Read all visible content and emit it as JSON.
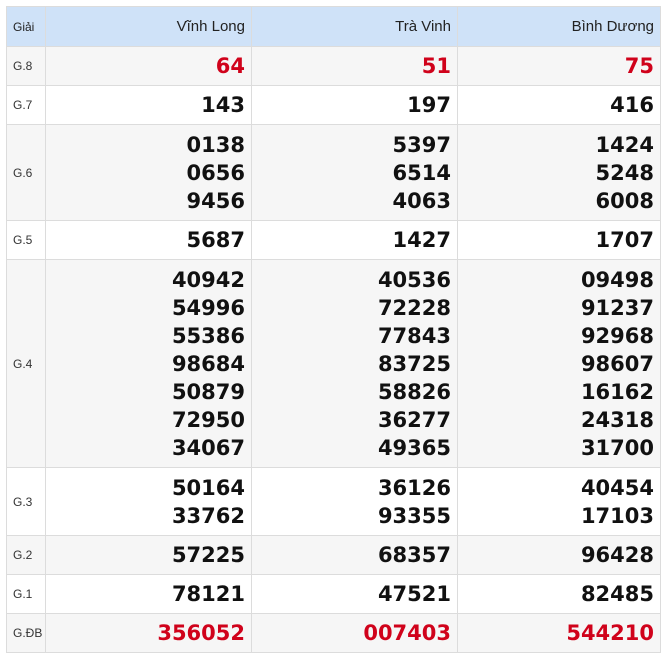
{
  "header": {
    "prize_label": "Giải",
    "provinces": [
      "Vĩnh Long",
      "Trà Vinh",
      "Bình Dương"
    ]
  },
  "rows": [
    {
      "prize": "G.8",
      "red": true,
      "cells": [
        [
          "64"
        ],
        [
          "51"
        ],
        [
          "75"
        ]
      ]
    },
    {
      "prize": "G.7",
      "red": false,
      "cells": [
        [
          "143"
        ],
        [
          "197"
        ],
        [
          "416"
        ]
      ]
    },
    {
      "prize": "G.6",
      "red": false,
      "cells": [
        [
          "0138",
          "0656",
          "9456"
        ],
        [
          "5397",
          "6514",
          "4063"
        ],
        [
          "1424",
          "5248",
          "6008"
        ]
      ]
    },
    {
      "prize": "G.5",
      "red": false,
      "cells": [
        [
          "5687"
        ],
        [
          "1427"
        ],
        [
          "1707"
        ]
      ]
    },
    {
      "prize": "G.4",
      "red": false,
      "cells": [
        [
          "40942",
          "54996",
          "55386",
          "98684",
          "50879",
          "72950",
          "34067"
        ],
        [
          "40536",
          "72228",
          "77843",
          "83725",
          "58826",
          "36277",
          "49365"
        ],
        [
          "09498",
          "91237",
          "92968",
          "98607",
          "16162",
          "24318",
          "31700"
        ]
      ]
    },
    {
      "prize": "G.3",
      "red": false,
      "cells": [
        [
          "50164",
          "33762"
        ],
        [
          "36126",
          "93355"
        ],
        [
          "40454",
          "17103"
        ]
      ]
    },
    {
      "prize": "G.2",
      "red": false,
      "cells": [
        [
          "57225"
        ],
        [
          "68357"
        ],
        [
          "96428"
        ]
      ]
    },
    {
      "prize": "G.1",
      "red": false,
      "cells": [
        [
          "78121"
        ],
        [
          "47521"
        ],
        [
          "82485"
        ]
      ]
    },
    {
      "prize": "G.ĐB",
      "red": true,
      "cells": [
        [
          "356052"
        ],
        [
          "007403"
        ],
        [
          "544210"
        ]
      ]
    }
  ],
  "colors": {
    "red": "#d0021b",
    "header_bg": "#cfe2f8"
  }
}
